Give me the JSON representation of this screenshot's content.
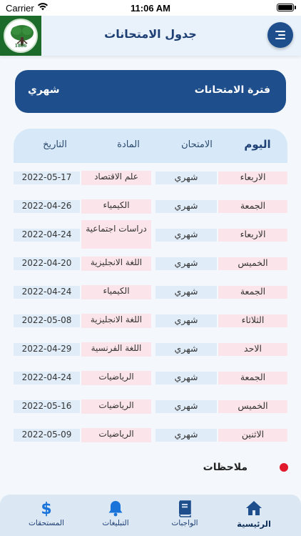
{
  "status_bar": {
    "carrier": "Carrier",
    "time": "11:06 AM"
  },
  "header": {
    "title": "جدول الامتحانات",
    "logo_year": "1886"
  },
  "period": {
    "label": "فترة الامتحانات",
    "value": "شهري"
  },
  "table": {
    "headers": {
      "day": "اليوم",
      "exam": "الامتحان",
      "subject": "المادة",
      "date": "التاريخ"
    },
    "rows": [
      {
        "day": "الاربعاء",
        "exam": "شهري",
        "subject": "علم الاقتصاد",
        "date": "2022-05-17"
      },
      {
        "day": "الجمعة",
        "exam": "شهري",
        "subject": "الكيمياء",
        "date": "2022-04-26"
      },
      {
        "day": "الاربعاء",
        "exam": "شهري",
        "subject": "دراسات اجتماعية",
        "date": "2022-04-24"
      },
      {
        "day": "الخميس",
        "exam": "شهري",
        "subject": "اللغة الانجليزية",
        "date": "2022-04-20"
      },
      {
        "day": "الجمعة",
        "exam": "شهري",
        "subject": "الكيمياء",
        "date": "2022-04-24"
      },
      {
        "day": "الثلاثاء",
        "exam": "شهري",
        "subject": "اللغة الانجليزية",
        "date": "2022-05-08"
      },
      {
        "day": "الاحد",
        "exam": "شهري",
        "subject": "اللغة الفرنسية",
        "date": "2022-04-29"
      },
      {
        "day": "الجمعة",
        "exam": "شهري",
        "subject": "الرياضيات",
        "date": "2022-04-24"
      },
      {
        "day": "الخميس",
        "exam": "شهري",
        "subject": "الرياضيات",
        "date": "2022-05-16"
      },
      {
        "day": "الاثنين",
        "exam": "شهري",
        "subject": "الرياضيات",
        "date": "2022-05-09"
      }
    ]
  },
  "notes": {
    "label": "ملاحظات"
  },
  "tabbar": {
    "home": "الرئيسية",
    "homework": "الواجبات",
    "notifications": "التبليغات",
    "fees": "المستحقات"
  },
  "colors": {
    "primary": "#1e4f8c",
    "header_bg": "#e9f2fb",
    "logo_bg": "#1c6b2a",
    "pink_cell": "#fbe4ea",
    "blue_cell": "#e0edf8",
    "notes_dot": "#e0192d"
  }
}
